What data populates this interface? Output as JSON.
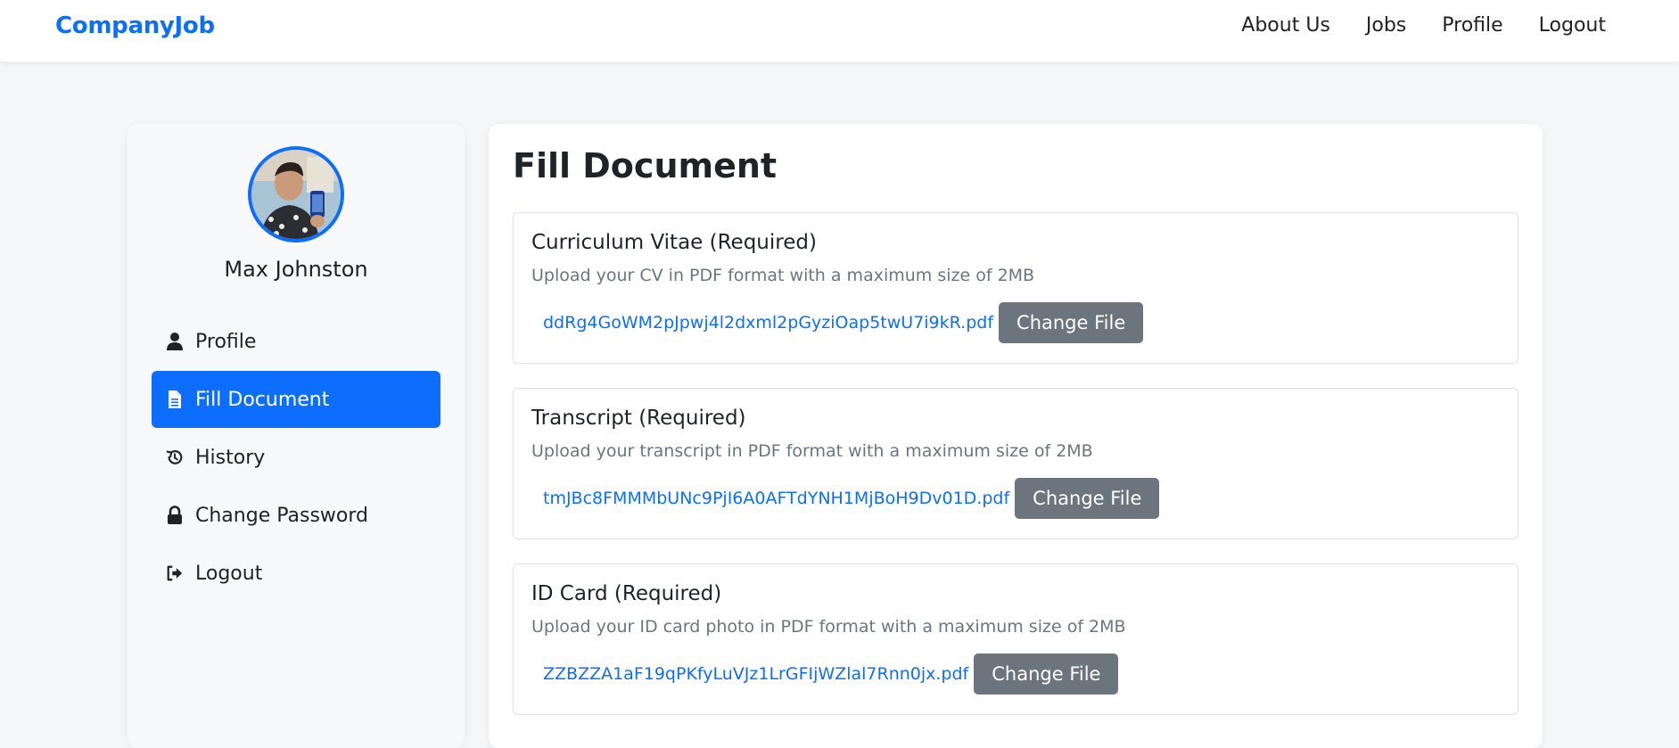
{
  "nav": {
    "brand": "CompanyJob",
    "links": [
      "About Us",
      "Jobs",
      "Profile",
      "Logout"
    ]
  },
  "sidebar": {
    "user_name": "Max Johnston",
    "items": [
      {
        "label": "Profile",
        "icon": "user-icon",
        "active": false
      },
      {
        "label": "Fill Document",
        "icon": "document-icon",
        "active": true
      },
      {
        "label": "History",
        "icon": "history-icon",
        "active": false
      },
      {
        "label": "Change Password",
        "icon": "lock-icon",
        "active": false
      },
      {
        "label": "Logout",
        "icon": "logout-icon",
        "active": false
      }
    ]
  },
  "main": {
    "title": "Fill Document",
    "documents": [
      {
        "title": "Curriculum Vitae (Required)",
        "description": "Upload your CV in PDF format with a maximum size of 2MB",
        "file_name": "ddRg4GoWM2pJpwj4l2dxml2pGyziOap5twU7i9kR.pdf",
        "button": "Change File"
      },
      {
        "title": "Transcript (Required)",
        "description": "Upload your transcript in PDF format with a maximum size of 2MB",
        "file_name": "tmJBc8FMMMbUNc9PjI6A0AFTdYNH1MjBoH9Dv01D.pdf",
        "button": "Change File"
      },
      {
        "title": "ID Card (Required)",
        "description": "Upload your ID card photo in PDF format with a maximum size of 2MB",
        "file_name": "ZZBZZA1aF19qPKfyLuVJz1LrGFIjWZlal7Rnn0jx.pdf",
        "button": "Change File"
      }
    ]
  },
  "colors": {
    "primary": "#0d6efd",
    "secondary_button": "#6c757d",
    "muted_text": "#6c757d",
    "page_bg": "#f5f6f8"
  }
}
